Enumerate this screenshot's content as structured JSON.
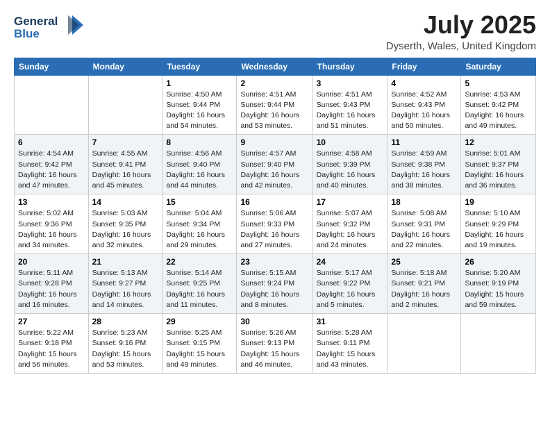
{
  "header": {
    "logo_line1": "General",
    "logo_line2": "Blue",
    "month": "July 2025",
    "location": "Dyserth, Wales, United Kingdom"
  },
  "weekdays": [
    "Sunday",
    "Monday",
    "Tuesday",
    "Wednesday",
    "Thursday",
    "Friday",
    "Saturday"
  ],
  "weeks": [
    [
      {
        "day": null,
        "sunrise": null,
        "sunset": null,
        "daylight": null
      },
      {
        "day": null,
        "sunrise": null,
        "sunset": null,
        "daylight": null
      },
      {
        "day": "1",
        "sunrise": "Sunrise: 4:50 AM",
        "sunset": "Sunset: 9:44 PM",
        "daylight": "Daylight: 16 hours and 54 minutes."
      },
      {
        "day": "2",
        "sunrise": "Sunrise: 4:51 AM",
        "sunset": "Sunset: 9:44 PM",
        "daylight": "Daylight: 16 hours and 53 minutes."
      },
      {
        "day": "3",
        "sunrise": "Sunrise: 4:51 AM",
        "sunset": "Sunset: 9:43 PM",
        "daylight": "Daylight: 16 hours and 51 minutes."
      },
      {
        "day": "4",
        "sunrise": "Sunrise: 4:52 AM",
        "sunset": "Sunset: 9:43 PM",
        "daylight": "Daylight: 16 hours and 50 minutes."
      },
      {
        "day": "5",
        "sunrise": "Sunrise: 4:53 AM",
        "sunset": "Sunset: 9:42 PM",
        "daylight": "Daylight: 16 hours and 49 minutes."
      }
    ],
    [
      {
        "day": "6",
        "sunrise": "Sunrise: 4:54 AM",
        "sunset": "Sunset: 9:42 PM",
        "daylight": "Daylight: 16 hours and 47 minutes."
      },
      {
        "day": "7",
        "sunrise": "Sunrise: 4:55 AM",
        "sunset": "Sunset: 9:41 PM",
        "daylight": "Daylight: 16 hours and 45 minutes."
      },
      {
        "day": "8",
        "sunrise": "Sunrise: 4:56 AM",
        "sunset": "Sunset: 9:40 PM",
        "daylight": "Daylight: 16 hours and 44 minutes."
      },
      {
        "day": "9",
        "sunrise": "Sunrise: 4:57 AM",
        "sunset": "Sunset: 9:40 PM",
        "daylight": "Daylight: 16 hours and 42 minutes."
      },
      {
        "day": "10",
        "sunrise": "Sunrise: 4:58 AM",
        "sunset": "Sunset: 9:39 PM",
        "daylight": "Daylight: 16 hours and 40 minutes."
      },
      {
        "day": "11",
        "sunrise": "Sunrise: 4:59 AM",
        "sunset": "Sunset: 9:38 PM",
        "daylight": "Daylight: 16 hours and 38 minutes."
      },
      {
        "day": "12",
        "sunrise": "Sunrise: 5:01 AM",
        "sunset": "Sunset: 9:37 PM",
        "daylight": "Daylight: 16 hours and 36 minutes."
      }
    ],
    [
      {
        "day": "13",
        "sunrise": "Sunrise: 5:02 AM",
        "sunset": "Sunset: 9:36 PM",
        "daylight": "Daylight: 16 hours and 34 minutes."
      },
      {
        "day": "14",
        "sunrise": "Sunrise: 5:03 AM",
        "sunset": "Sunset: 9:35 PM",
        "daylight": "Daylight: 16 hours and 32 minutes."
      },
      {
        "day": "15",
        "sunrise": "Sunrise: 5:04 AM",
        "sunset": "Sunset: 9:34 PM",
        "daylight": "Daylight: 16 hours and 29 minutes."
      },
      {
        "day": "16",
        "sunrise": "Sunrise: 5:06 AM",
        "sunset": "Sunset: 9:33 PM",
        "daylight": "Daylight: 16 hours and 27 minutes."
      },
      {
        "day": "17",
        "sunrise": "Sunrise: 5:07 AM",
        "sunset": "Sunset: 9:32 PM",
        "daylight": "Daylight: 16 hours and 24 minutes."
      },
      {
        "day": "18",
        "sunrise": "Sunrise: 5:08 AM",
        "sunset": "Sunset: 9:31 PM",
        "daylight": "Daylight: 16 hours and 22 minutes."
      },
      {
        "day": "19",
        "sunrise": "Sunrise: 5:10 AM",
        "sunset": "Sunset: 9:29 PM",
        "daylight": "Daylight: 16 hours and 19 minutes."
      }
    ],
    [
      {
        "day": "20",
        "sunrise": "Sunrise: 5:11 AM",
        "sunset": "Sunset: 9:28 PM",
        "daylight": "Daylight: 16 hours and 16 minutes."
      },
      {
        "day": "21",
        "sunrise": "Sunrise: 5:13 AM",
        "sunset": "Sunset: 9:27 PM",
        "daylight": "Daylight: 16 hours and 14 minutes."
      },
      {
        "day": "22",
        "sunrise": "Sunrise: 5:14 AM",
        "sunset": "Sunset: 9:25 PM",
        "daylight": "Daylight: 16 hours and 11 minutes."
      },
      {
        "day": "23",
        "sunrise": "Sunrise: 5:15 AM",
        "sunset": "Sunset: 9:24 PM",
        "daylight": "Daylight: 16 hours and 8 minutes."
      },
      {
        "day": "24",
        "sunrise": "Sunrise: 5:17 AM",
        "sunset": "Sunset: 9:22 PM",
        "daylight": "Daylight: 16 hours and 5 minutes."
      },
      {
        "day": "25",
        "sunrise": "Sunrise: 5:18 AM",
        "sunset": "Sunset: 9:21 PM",
        "daylight": "Daylight: 16 hours and 2 minutes."
      },
      {
        "day": "26",
        "sunrise": "Sunrise: 5:20 AM",
        "sunset": "Sunset: 9:19 PM",
        "daylight": "Daylight: 15 hours and 59 minutes."
      }
    ],
    [
      {
        "day": "27",
        "sunrise": "Sunrise: 5:22 AM",
        "sunset": "Sunset: 9:18 PM",
        "daylight": "Daylight: 15 hours and 56 minutes."
      },
      {
        "day": "28",
        "sunrise": "Sunrise: 5:23 AM",
        "sunset": "Sunset: 9:16 PM",
        "daylight": "Daylight: 15 hours and 53 minutes."
      },
      {
        "day": "29",
        "sunrise": "Sunrise: 5:25 AM",
        "sunset": "Sunset: 9:15 PM",
        "daylight": "Daylight: 15 hours and 49 minutes."
      },
      {
        "day": "30",
        "sunrise": "Sunrise: 5:26 AM",
        "sunset": "Sunset: 9:13 PM",
        "daylight": "Daylight: 15 hours and 46 minutes."
      },
      {
        "day": "31",
        "sunrise": "Sunrise: 5:28 AM",
        "sunset": "Sunset: 9:11 PM",
        "daylight": "Daylight: 15 hours and 43 minutes."
      },
      {
        "day": null,
        "sunrise": null,
        "sunset": null,
        "daylight": null
      },
      {
        "day": null,
        "sunrise": null,
        "sunset": null,
        "daylight": null
      }
    ]
  ]
}
